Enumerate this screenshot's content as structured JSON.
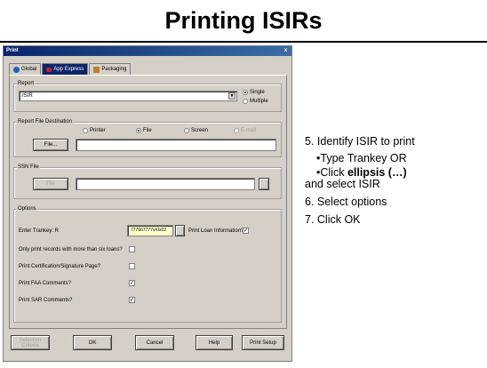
{
  "slide": {
    "title": "Printing ISIRs"
  },
  "dialog": {
    "title": "Print",
    "close_glyph": "x",
    "tabs": [
      {
        "label": "Global",
        "icon": "globe-icon",
        "active": false
      },
      {
        "label": "App Express",
        "icon": "app-express-icon",
        "active": true
      },
      {
        "label": "Packaging",
        "icon": "package-icon",
        "active": false
      }
    ],
    "report": {
      "group_label": "Report",
      "selected": "ISIR",
      "mode_single": "Single",
      "mode_multiple": "Multiple"
    },
    "destination": {
      "group_label": "Report File Destination",
      "printer": "Printer",
      "file": "File",
      "screen": "Screen",
      "email": "E-mail",
      "file_button": "File...",
      "file_value": ""
    },
    "ssn_file": {
      "group_label": "SSN File",
      "file_button": "File",
      "value": ""
    },
    "options": {
      "group_label": "Options",
      "trankey_label": "Enter Trankey: R",
      "trankey_value": "777667777vr0x02",
      "print_loan_label": "Print Loan Information?",
      "only_records_label": "Only print records with more than six loans?",
      "certification_label": "Print Certification/Signature Page?",
      "faa_comments_label": "Print FAA Comments?",
      "sar_comments_label": "Print SAR Comments?",
      "check_glyph": "✓"
    },
    "buttons": {
      "selection_criteria": "Selection Criteria",
      "ok": "OK",
      "cancel": "Cancel",
      "help": "Help",
      "print_setup": "Print Setup"
    }
  },
  "instructions": {
    "step5": "5. Identify ISIR to print",
    "step5a": "•Type Trankey OR",
    "step5b_prefix": "•Click ",
    "step5b_bold": "ellipsis (…)",
    "step5b_suffix": "and select ISIR",
    "step6": "6. Select options",
    "step7": "7. Click OK"
  },
  "colors": {
    "titlebar": "#0a246a",
    "dialog_bg": "#d4d0c8",
    "trankey_bg": "#ffffcc"
  }
}
